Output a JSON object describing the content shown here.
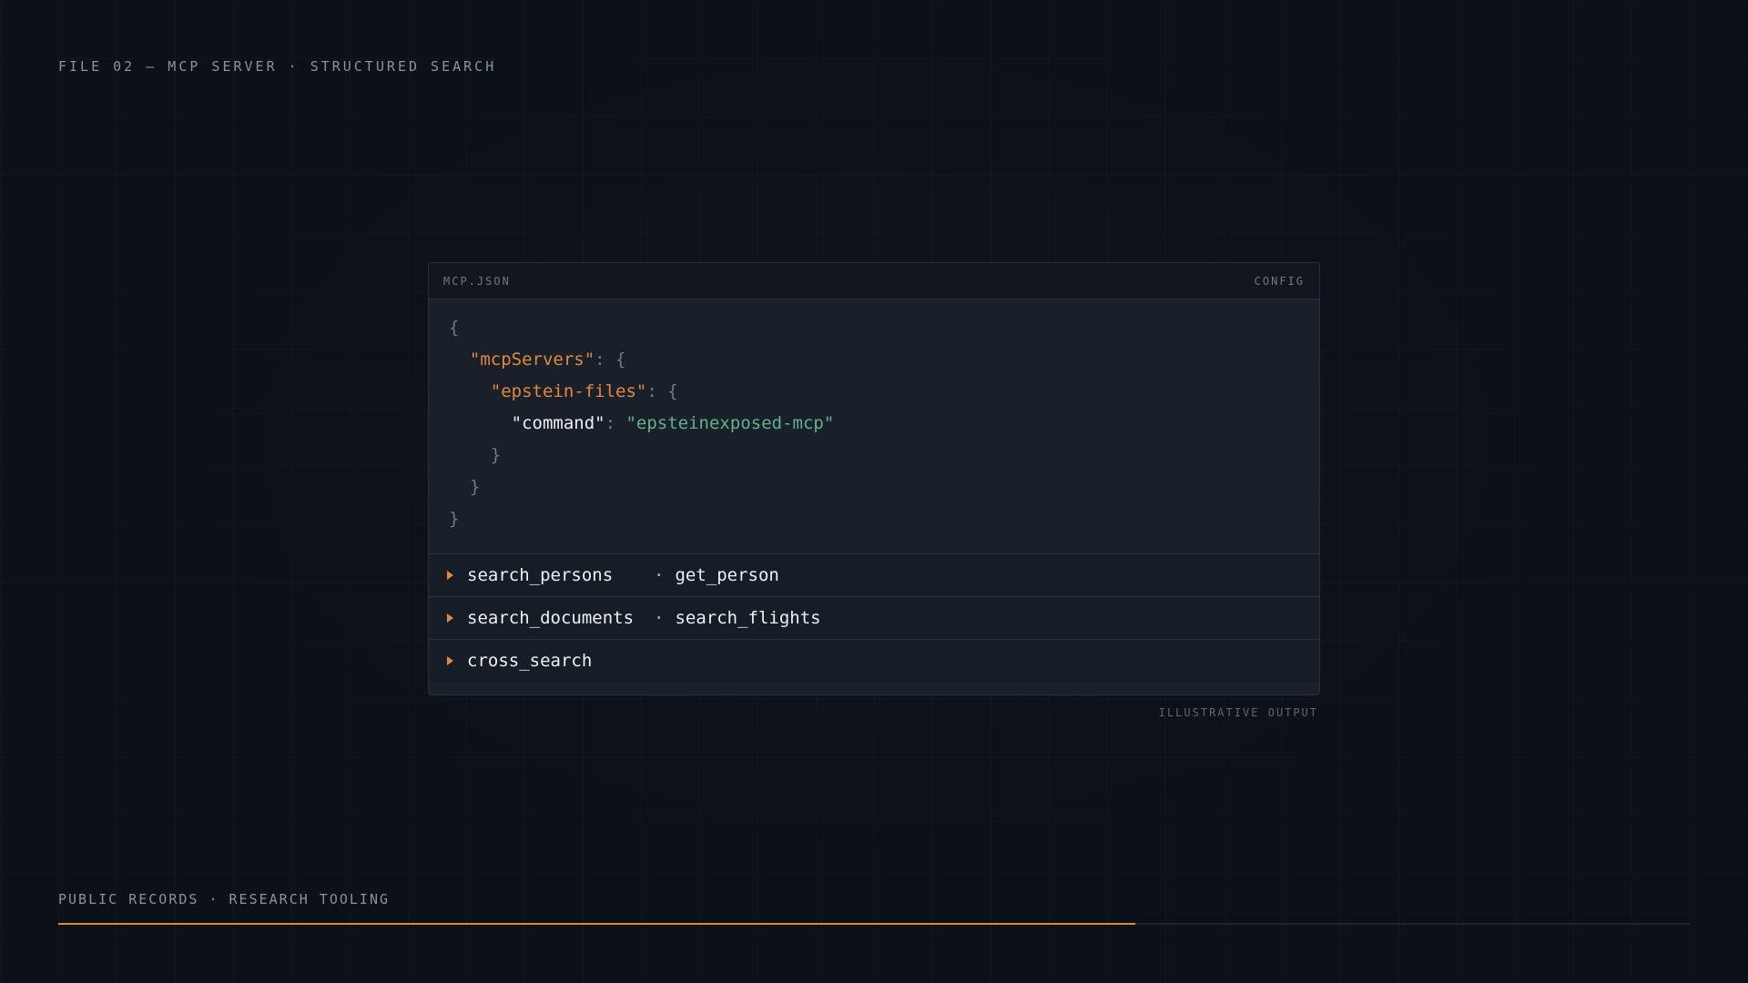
{
  "header": {
    "title": "FILE 02 — MCP SERVER · STRUCTURED SEARCH"
  },
  "panel": {
    "filename": "MCP.JSON",
    "tag": "CONFIG",
    "code": {
      "open_brace": "{",
      "servers_key": "\"mcpServers\"",
      "server_key": "\"epstein-files\"",
      "command_key": "\"command\"",
      "command_value": "\"epsteinexposed-mcp\"",
      "colon_brace": ": {",
      "colon": ": ",
      "close_brace": "}"
    },
    "tools": [
      {
        "primary": "search_persons",
        "secondary": "get_person"
      },
      {
        "primary": "search_documents",
        "secondary": "search_flights"
      },
      {
        "primary": "cross_search",
        "secondary": ""
      }
    ],
    "separator": "·"
  },
  "footnote": "ILLUSTRATIVE OUTPUT",
  "footer": {
    "label": "PUBLIC RECORDS · RESEARCH TOOLING",
    "progress": 0.66
  },
  "colors": {
    "accent": "#e0893a",
    "string": "#63b08b",
    "background": "#0c1017",
    "panel": "#19202a"
  }
}
